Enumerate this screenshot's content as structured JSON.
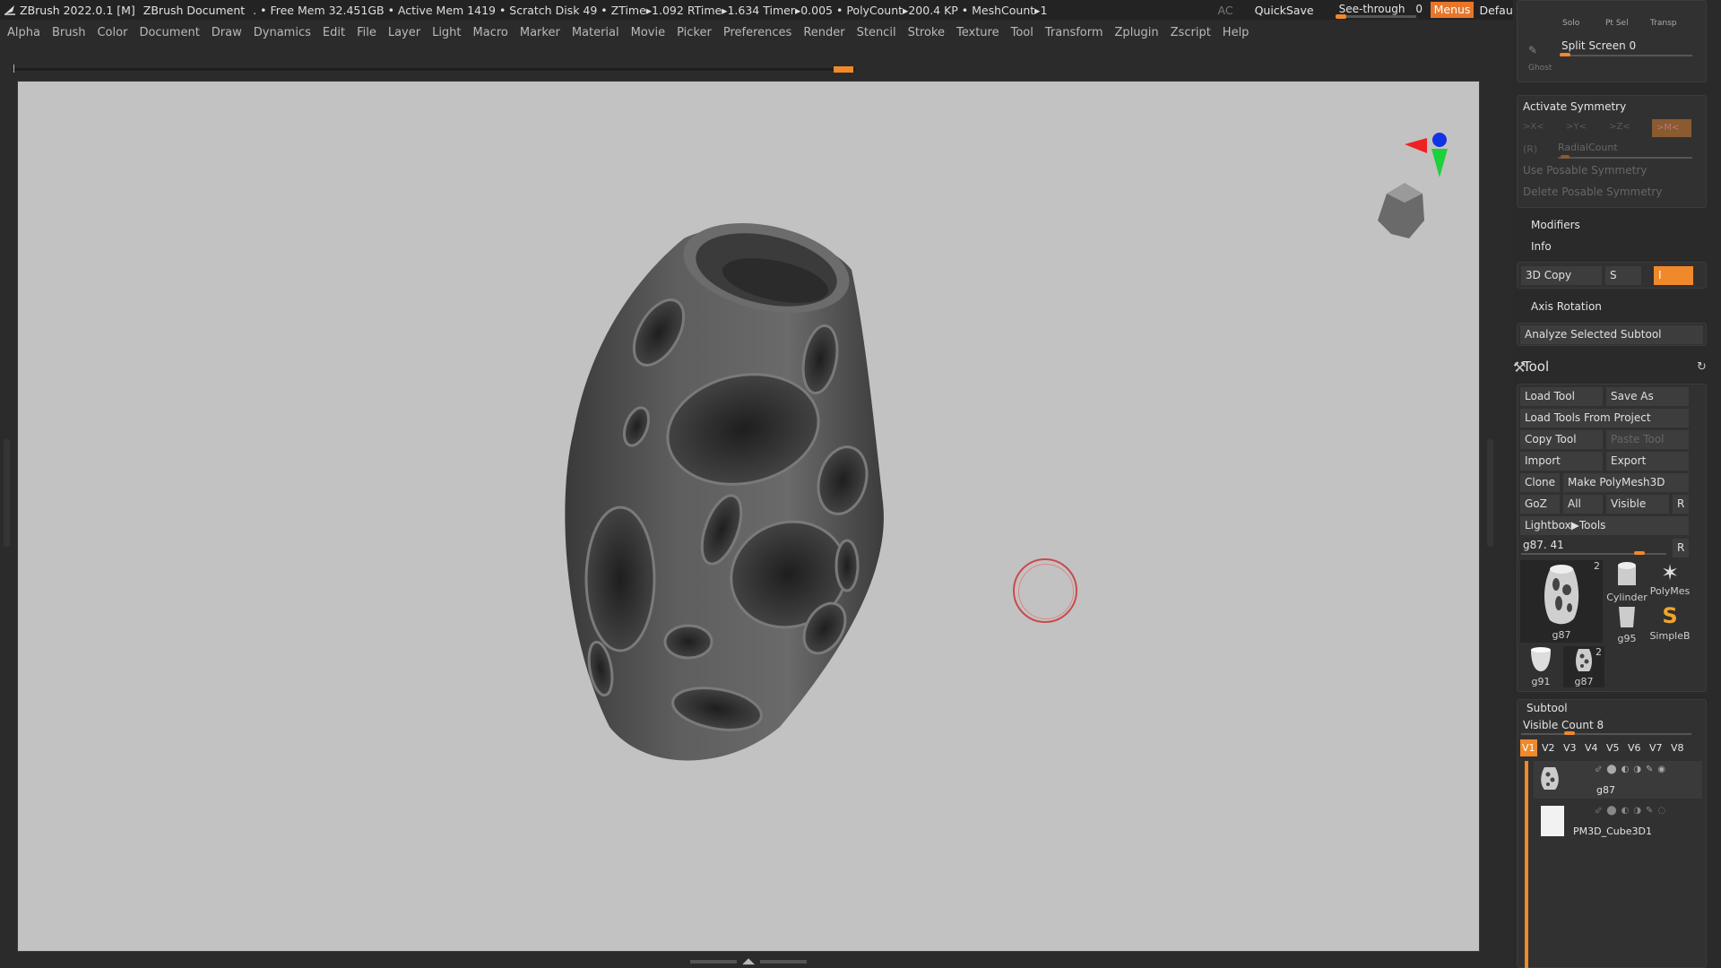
{
  "titlebar": {
    "app": "ZBrush 2022.0.1 [M]",
    "document": "ZBrush Document",
    "stats": ". • Free Mem 32.451GB • Active Mem 1419 • Scratch Disk 49 • ZTime▸1.092 RTime▸1.634 Timer▸0.005 • PolyCount▸200.4 KP • MeshCount▸1",
    "ac": "AC",
    "quicksave": "QuickSave",
    "see_through_label": "See-through",
    "see_through_value": "0",
    "menus": "Menus",
    "default_zscript": "DefaultZScript"
  },
  "menubar": [
    "Alpha",
    "Brush",
    "Color",
    "Document",
    "Draw",
    "Dynamics",
    "Edit",
    "File",
    "Layer",
    "Light",
    "Macro",
    "Marker",
    "Material",
    "Movie",
    "Picker",
    "Preferences",
    "Render",
    "Stencil",
    "Stroke",
    "Texture",
    "Tool",
    "Transform",
    "Zplugin",
    "Zscript",
    "Help"
  ],
  "tray": {
    "top_icons": [
      "Solo",
      "Pt Sel",
      "Transp"
    ],
    "ghost": "Ghost",
    "split_screen": "Split Screen 0",
    "symmetry": {
      "title": "Activate Symmetry",
      "x": ">X<",
      "y": ">Y<",
      "z": ">Z<",
      "m": ">M<",
      "r": "(R)",
      "radial_count": "RadialCount",
      "use_posable": "Use Posable Symmetry",
      "delete_posable": "Delete Posable Symmetry"
    },
    "modifiers": "Modifiers",
    "info": "Info",
    "copy3d": "3D Copy",
    "copy_s": "S",
    "copy_i": "I",
    "axis_rotation": "Axis Rotation",
    "analyze": "Analyze Selected Subtool",
    "tool": {
      "title": "Tool",
      "load_tool": "Load Tool",
      "save_as": "Save As",
      "load_from_project": "Load Tools From Project",
      "copy_tool": "Copy Tool",
      "paste_tool": "Paste Tool",
      "import": "Import",
      "export": "Export",
      "clone": "Clone",
      "make_polymesh": "Make PolyMesh3D",
      "goz": "GoZ",
      "all": "All",
      "visible": "Visible",
      "r": "R",
      "lightbox": "Lightbox▶Tools",
      "current": "g87. 41",
      "thumbs": {
        "main": {
          "label": "g87",
          "count": "2"
        },
        "cylinder": "Cylinder",
        "polymesh": "PolyMes",
        "g95": "g95",
        "simpleb": "SimpleB",
        "g91": "g91",
        "g87b": {
          "label": "g87",
          "count": "2"
        }
      }
    },
    "subtool": {
      "title": "Subtool",
      "visible_count": "Visible Count 8",
      "versions": [
        "V1",
        "V2",
        "V3",
        "V4",
        "V5",
        "V6",
        "V7",
        "V8"
      ],
      "items": [
        "g87",
        "PM3D_Cube3D1"
      ]
    }
  }
}
